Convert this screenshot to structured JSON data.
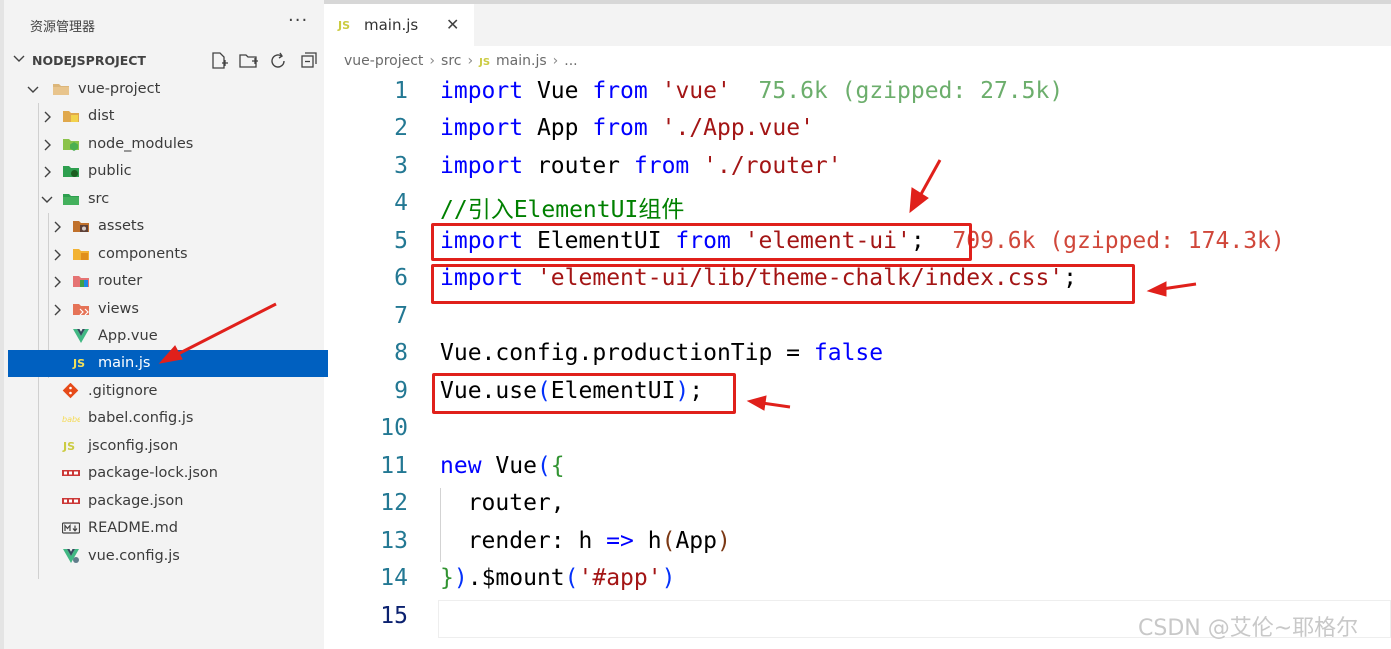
{
  "explorer": {
    "title": "资源管理器",
    "more": "···",
    "section_title": "NODEJSPROJECT",
    "items": [
      {
        "label": "vue-project",
        "icon": "folder-icon"
      },
      {
        "label": "dist",
        "icon": "folder-dist-icon"
      },
      {
        "label": "node_modules",
        "icon": "folder-node-icon"
      },
      {
        "label": "public",
        "icon": "folder-public-icon"
      },
      {
        "label": "src",
        "icon": "folder-src-icon"
      },
      {
        "label": "assets",
        "icon": "folder-assets-icon"
      },
      {
        "label": "components",
        "icon": "folder-components-icon"
      },
      {
        "label": "router",
        "icon": "folder-router-icon"
      },
      {
        "label": "views",
        "icon": "folder-views-icon"
      },
      {
        "label": "App.vue",
        "icon": "vue-file-icon"
      },
      {
        "label": "main.js",
        "icon": "js-file-icon"
      },
      {
        "label": ".gitignore",
        "icon": "git-file-icon"
      },
      {
        "label": "babel.config.js",
        "icon": "babel-file-icon"
      },
      {
        "label": "jsconfig.json",
        "icon": "js-file-icon"
      },
      {
        "label": "package-lock.json",
        "icon": "npm-file-icon"
      },
      {
        "label": "package.json",
        "icon": "npm-file-icon"
      },
      {
        "label": "README.md",
        "icon": "markdown-file-icon"
      },
      {
        "label": "vue.config.js",
        "icon": "vue-config-file-icon"
      }
    ]
  },
  "tab": {
    "badge": "JS",
    "label": "main.js",
    "close": "✕"
  },
  "breadcrumb": {
    "parts": [
      "vue-project",
      "src",
      "main.js",
      "..."
    ],
    "badge": "JS",
    "sep": "›"
  },
  "code": {
    "line_numbers": [
      "1",
      "2",
      "3",
      "4",
      "5",
      "6",
      "7",
      "8",
      "9",
      "10",
      "11",
      "12",
      "13",
      "14",
      "15"
    ],
    "l1": {
      "import": "import",
      "name": " Vue ",
      "from": "from",
      "sp": " ",
      "str": "'vue'",
      "hint": "  75.6k (gzipped: 27.5k)"
    },
    "l2": {
      "import": "import",
      "name": " App ",
      "from": "from",
      "sp": " ",
      "str": "'./App.vue'"
    },
    "l3": {
      "import": "import",
      "name": " router ",
      "from": "from",
      "sp": " ",
      "str": "'./router'"
    },
    "l4": {
      "comment": "//引入ElementUI组件"
    },
    "l5": {
      "import": "import",
      "name": " ElementUI ",
      "from": "from",
      "sp": " ",
      "str": "'element-ui'",
      "semi": ";",
      "hint": "  709.6k (gzipped: 174.3k)"
    },
    "l6": {
      "import": "import",
      "sp": " ",
      "str": "'element-ui/lib/theme-chalk/index.css'",
      "semi": ";"
    },
    "l8": {
      "pre": "Vue.config.productionTip = ",
      "val": "false"
    },
    "l9": {
      "pre": "Vue.use",
      "open": "(",
      "arg": "ElementUI",
      "close": ")",
      "semi": ";"
    },
    "l11": {
      "kw": "new",
      "name": " Vue",
      "paren": "(",
      "brace": "{"
    },
    "l12": {
      "text": "  router,"
    },
    "l13": {
      "pre": "  render: h ",
      "arrow": "=>",
      "fn": " h",
      "open": "(",
      "arg": "App",
      "close": ")"
    },
    "l14": {
      "brace": "}",
      "paren": ")",
      "mid": ".$mount",
      "open": "(",
      "str": "'#app'",
      "close": ")"
    }
  },
  "watermark": "CSDN @艾伦~耶格尔"
}
